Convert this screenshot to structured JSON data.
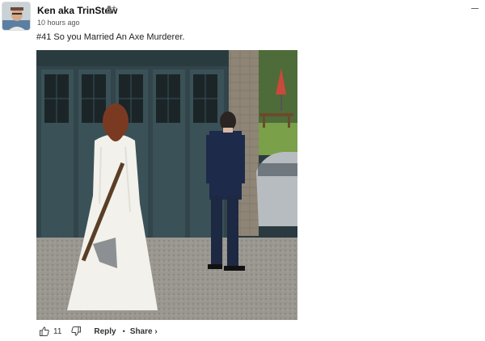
{
  "post": {
    "author": "Ken aka TrinStew",
    "time": "10 hours ago",
    "text": "#41 So you Married An Axe Murderer."
  },
  "actions": {
    "like_count": "11",
    "reply_label": "Reply",
    "separator": "•",
    "share_label": "Share ›"
  },
  "icons": [
    "follow-user-icon",
    "menu-collapse-icon",
    "thumbs-up-icon",
    "thumbs-down-icon"
  ]
}
